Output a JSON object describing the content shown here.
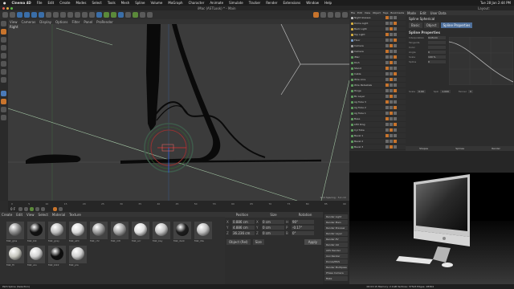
{
  "menubar": {
    "app": "Cinema 4D",
    "items": [
      "File",
      "Edit",
      "Create",
      "Modes",
      "Select",
      "Tools",
      "Mesh",
      "Spline",
      "Volume",
      "MoGraph",
      "Character",
      "Animate",
      "Simulate",
      "Tracker",
      "Render",
      "Extensions",
      "Window",
      "Help"
    ],
    "clock": "Tue 28 Jan 2:44 PM"
  },
  "titlebar": {
    "title": "iMac (ASTLook) * - Main",
    "layout_label": "Layout:"
  },
  "viewport": {
    "menu": [
      "View",
      "Cameras",
      "Display",
      "Options",
      "Filter",
      "Panel",
      "ProRender"
    ],
    "view_name": "Right",
    "grid_text": "Grid Spacing : 5.0 cm"
  },
  "timeline": {
    "ticks": [
      "0",
      "5",
      "10",
      "15",
      "20",
      "25",
      "30",
      "35",
      "40",
      "45",
      "50",
      "55",
      "60",
      "65",
      "70",
      "75",
      "80",
      "85",
      "90"
    ],
    "frame": "0 F"
  },
  "materials": {
    "menu": [
      "Create",
      "Edit",
      "View",
      "Select",
      "Material",
      "Texture"
    ],
    "items": [
      {
        "label": "Mat_glos",
        "color": "#8a8a8a"
      },
      {
        "label": "Mat_blk",
        "color": "#111111"
      },
      {
        "label": "Mat_gray",
        "color": "#bdbdbd"
      },
      {
        "label": "Mat_wht",
        "color": "#d9d9d9"
      },
      {
        "label": "Mat_chr",
        "color": "#9a9a9a"
      },
      {
        "label": "Mat_mtl",
        "color": "#a3a3a3"
      },
      {
        "label": "Mat_scr",
        "color": "#dedede"
      },
      {
        "label": "Mat_key",
        "color": "#c4c4c4"
      },
      {
        "label": "Mat_dark",
        "color": "#1d1d1d"
      },
      {
        "label": "Mat_lite",
        "color": "#bfbfbf"
      },
      {
        "label": "Mat_flr",
        "color": "#c8c8c0"
      },
      {
        "label": "Mat_alu",
        "color": "#d2d2d2"
      },
      {
        "label": "Mat_blk2",
        "color": "#0d0d0d"
      },
      {
        "label": "Mat_pla",
        "color": "#cfcfcf"
      }
    ]
  },
  "coords": {
    "headers": [
      "Position",
      "Size",
      "Rotation"
    ],
    "rows": [
      [
        "X",
        "0.886 cm",
        "X",
        "0 cm",
        "H",
        "90°"
      ],
      [
        "Y",
        "4.886 cm",
        "Y",
        "0 cm",
        "P",
        "-0.17°"
      ],
      [
        "Z",
        "36.236 cm",
        "Z",
        "0 cm",
        "B",
        "0°"
      ]
    ],
    "mode": "Object (Rel)",
    "size_mode": "Size",
    "apply": "Apply"
  },
  "render_buttons": [
    "Render Light",
    "Render Main",
    "Render Preview",
    "Render Layer",
    "Render PV",
    "Render AO",
    "AOV Render",
    "Aux Render",
    "Dunes/MAS",
    "Render Multipass",
    "Phase Camera",
    "Bake"
  ],
  "objects": {
    "menu": [
      "File",
      "Edit",
      "View",
      "Object",
      "Tags",
      "Bookmarks"
    ],
    "rows": [
      "Night Glasses",
      "Dome Light",
      "Back Light",
      "Top Light",
      "Floor",
      "Camera",
      "Camera",
      "iMac",
      "Dish",
      "Stand",
      "Cable",
      "Wire Arcs",
      "Wire Pedestals",
      "Hinge",
      "Bo Layer",
      "Ag Tube 3",
      "Ag Tube 2",
      "Ag Tube 1",
      "Base",
      "LED Ring",
      "Cyl Tube",
      "Bevel 1",
      "Bevel 2",
      "Bevel 3",
      "Mouse",
      "Engraving",
      "Keyboard_Mesh"
    ]
  },
  "attributes": {
    "tabs": [
      "Mode",
      "Edit",
      "User Data"
    ],
    "title": "Spline Spherical",
    "subtabs": [
      "Basic",
      "Object",
      "Spline Properties"
    ],
    "section": "Spline Properties",
    "fields": [
      [
        "Interpolation",
        "Uniform"
      ],
      [
        "Tangents",
        ""
      ],
      [
        "Color",
        ""
      ],
      [
        "Angle",
        "0"
      ],
      [
        "Scale",
        "100 %"
      ],
      [
        "Spline",
        "0"
      ]
    ],
    "small_labels": [
      "Scale",
      "Spin",
      "Tanner"
    ],
    "small_values": [
      "0.00",
      "1.000",
      "0"
    ],
    "footer": [
      "Shapes",
      "Splines",
      "Render"
    ]
  },
  "status": {
    "left": "Path Spline (Selection)",
    "right": "00:03:15 Memory: 2.1GB Vertices: 37523 Edges: 28364"
  }
}
